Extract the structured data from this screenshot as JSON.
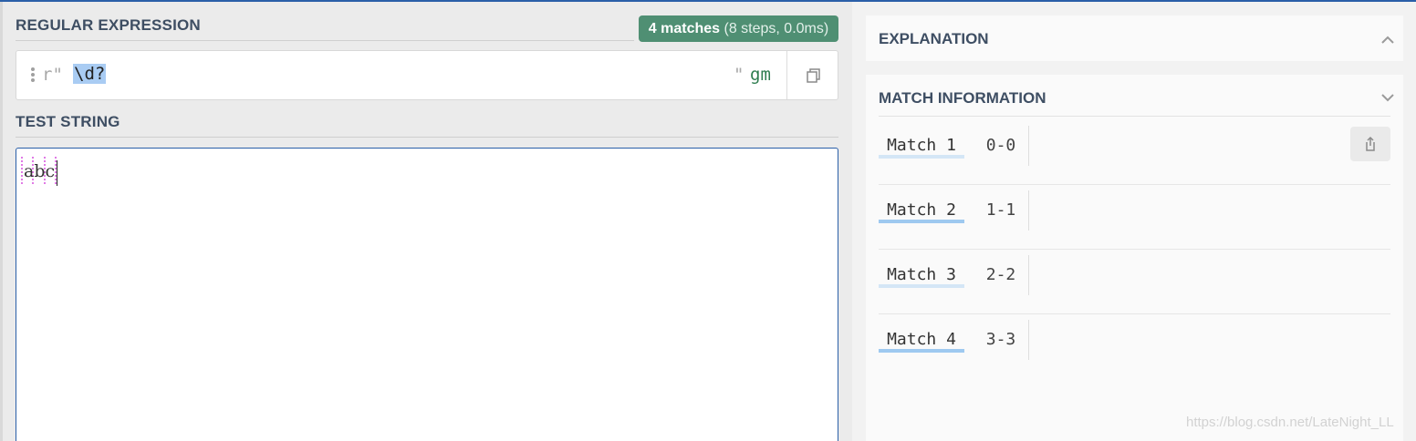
{
  "regex_section": {
    "title": "REGULAR EXPRESSION",
    "match_count": "4 matches",
    "match_stats": "(8 steps, 0.0ms)",
    "delimiter_open": "r\"",
    "pattern": "\\d?",
    "delimiter_close": "\"",
    "flags": "gm"
  },
  "test_section": {
    "title": "TEST STRING",
    "text": "abc"
  },
  "explanation": {
    "title": "EXPLANATION"
  },
  "match_info": {
    "title": "MATCH INFORMATION",
    "matches": [
      {
        "label": "Match 1",
        "range": "0-0"
      },
      {
        "label": "Match 2",
        "range": "1-1"
      },
      {
        "label": "Match 3",
        "range": "2-2"
      },
      {
        "label": "Match 4",
        "range": "3-3"
      }
    ]
  },
  "watermark": "https://blog.csdn.net/LateNight_LL",
  "colors": {
    "accent": "#2a5fa8",
    "badge": "#4f8f73",
    "highlight": "#a9ccf3",
    "match_marker": "#e07ae6",
    "flags": "#2e7d4f"
  },
  "icons": {
    "grip": "drag-handle-icon",
    "copy": "copy-icon",
    "collapse": "chevron-up-icon",
    "expand": "chevron-down-icon",
    "share": "share-icon"
  }
}
